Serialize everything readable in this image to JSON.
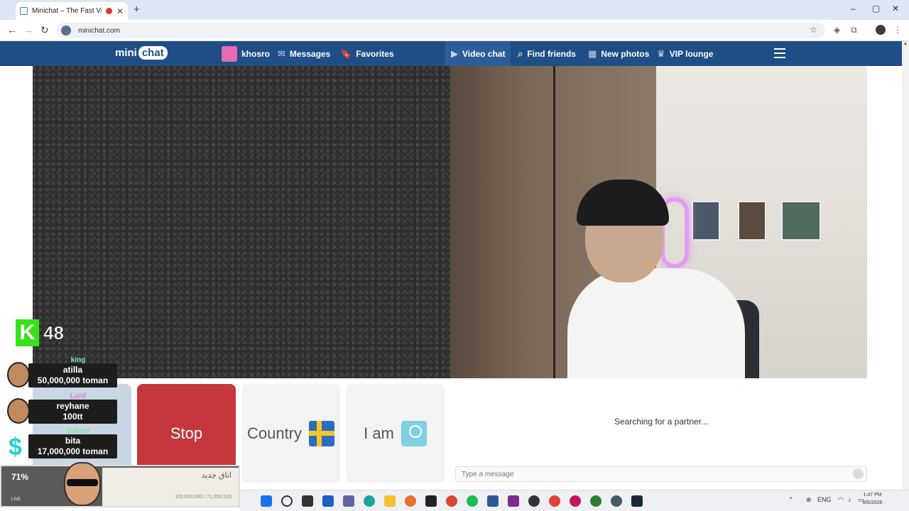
{
  "browser": {
    "tab_title": "Minichat – The Fast Video C",
    "tab_close": "✕",
    "new_tab": "+",
    "url": "minichat.com",
    "win_minimize": "–",
    "win_restore": "▢",
    "win_close": "✕"
  },
  "site": {
    "logo_mini": "mini",
    "logo_chat": "chat",
    "nav": {
      "username": "khosro",
      "messages": "Messages",
      "favorites": "Favorites",
      "video_chat": "Video chat",
      "find_friends": "Find friends",
      "new_photos": "New photos",
      "vip_lounge": "VIP lounge"
    },
    "controls": {
      "stop": "Stop",
      "country": "Country",
      "iam": "I am"
    },
    "chat": {
      "status": "Searching for a partner...",
      "placeholder": "Type a message"
    }
  },
  "overlay": {
    "viewer_count": "48",
    "k_letter": "K",
    "donors": [
      {
        "rank": "king",
        "name": "atilla",
        "amount": "50,000,000 toman",
        "rank_color": "#7fe3e8"
      },
      {
        "rank": "Lord",
        "name": "reyhane",
        "amount": "100tt",
        "rank_color": "#e07be0"
      },
      {
        "rank": "Solider",
        "name": "bita",
        "amount": "17,000,000 toman",
        "rank_color": "#7fe3a0"
      }
    ],
    "dollar": "$",
    "progress_pct": "71%",
    "live_label": "LIVE",
    "room_label": "اتاق جدید",
    "goal_text": "100,000,000 / 71,250,510"
  },
  "taskbar": {
    "lang": "ENG",
    "time": "1:47 PM",
    "date": "8/6/2026"
  }
}
